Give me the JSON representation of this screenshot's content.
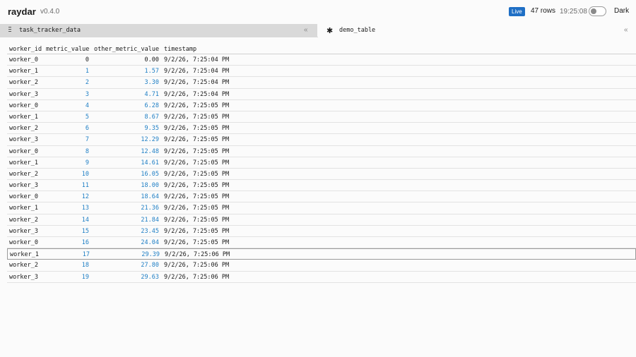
{
  "header": {
    "brand": "raydar",
    "version": "v0.4.0",
    "live_badge": "Live",
    "row_count": "47",
    "rows_label": "rows",
    "time": "19:25:08",
    "dark_label": "Dark",
    "toggle_on": false
  },
  "tabs": [
    {
      "label": "task_tracker_data",
      "active": true,
      "collapse_icon": "double-chevron-left-icon"
    },
    {
      "label": "demo_table",
      "active": false,
      "collapse_icon": "double-chevron-left-icon"
    }
  ],
  "table": {
    "columns": [
      "worker_id",
      "metric_value",
      "other_metric_value",
      "timestamp"
    ],
    "rows": [
      {
        "worker_id": "worker_0",
        "metric_value": "0",
        "other_metric_value": "0.00",
        "timestamp": "9/2/26, 7:25:04 PM"
      },
      {
        "worker_id": "worker_1",
        "metric_value": "1",
        "other_metric_value": "1.57",
        "timestamp": "9/2/26, 7:25:04 PM"
      },
      {
        "worker_id": "worker_2",
        "metric_value": "2",
        "other_metric_value": "3.30",
        "timestamp": "9/2/26, 7:25:04 PM"
      },
      {
        "worker_id": "worker_3",
        "metric_value": "3",
        "other_metric_value": "4.71",
        "timestamp": "9/2/26, 7:25:04 PM"
      },
      {
        "worker_id": "worker_0",
        "metric_value": "4",
        "other_metric_value": "6.28",
        "timestamp": "9/2/26, 7:25:05 PM"
      },
      {
        "worker_id": "worker_1",
        "metric_value": "5",
        "other_metric_value": "8.67",
        "timestamp": "9/2/26, 7:25:05 PM"
      },
      {
        "worker_id": "worker_2",
        "metric_value": "6",
        "other_metric_value": "9.35",
        "timestamp": "9/2/26, 7:25:05 PM"
      },
      {
        "worker_id": "worker_3",
        "metric_value": "7",
        "other_metric_value": "12.29",
        "timestamp": "9/2/26, 7:25:05 PM"
      },
      {
        "worker_id": "worker_0",
        "metric_value": "8",
        "other_metric_value": "12.48",
        "timestamp": "9/2/26, 7:25:05 PM"
      },
      {
        "worker_id": "worker_1",
        "metric_value": "9",
        "other_metric_value": "14.61",
        "timestamp": "9/2/26, 7:25:05 PM"
      },
      {
        "worker_id": "worker_2",
        "metric_value": "10",
        "other_metric_value": "16.05",
        "timestamp": "9/2/26, 7:25:05 PM"
      },
      {
        "worker_id": "worker_3",
        "metric_value": "11",
        "other_metric_value": "18.00",
        "timestamp": "9/2/26, 7:25:05 PM"
      },
      {
        "worker_id": "worker_0",
        "metric_value": "12",
        "other_metric_value": "18.64",
        "timestamp": "9/2/26, 7:25:05 PM"
      },
      {
        "worker_id": "worker_1",
        "metric_value": "13",
        "other_metric_value": "21.36",
        "timestamp": "9/2/26, 7:25:05 PM"
      },
      {
        "worker_id": "worker_2",
        "metric_value": "14",
        "other_metric_value": "21.84",
        "timestamp": "9/2/26, 7:25:05 PM"
      },
      {
        "worker_id": "worker_3",
        "metric_value": "15",
        "other_metric_value": "23.45",
        "timestamp": "9/2/26, 7:25:05 PM"
      },
      {
        "worker_id": "worker_0",
        "metric_value": "16",
        "other_metric_value": "24.04",
        "timestamp": "9/2/26, 7:25:05 PM"
      },
      {
        "worker_id": "worker_1",
        "metric_value": "17",
        "other_metric_value": "29.39",
        "timestamp": "9/2/26, 7:25:06 PM",
        "selected": true
      },
      {
        "worker_id": "worker_2",
        "metric_value": "18",
        "other_metric_value": "27.80",
        "timestamp": "9/2/26, 7:25:06 PM"
      },
      {
        "worker_id": "worker_3",
        "metric_value": "19",
        "other_metric_value": "29.63",
        "timestamp": "9/2/26, 7:25:06 PM"
      }
    ]
  },
  "colors": {
    "accent": "#1f6fc5",
    "number_text": "#1f7fc5",
    "active_tab_bg": "#d9d9d9"
  }
}
